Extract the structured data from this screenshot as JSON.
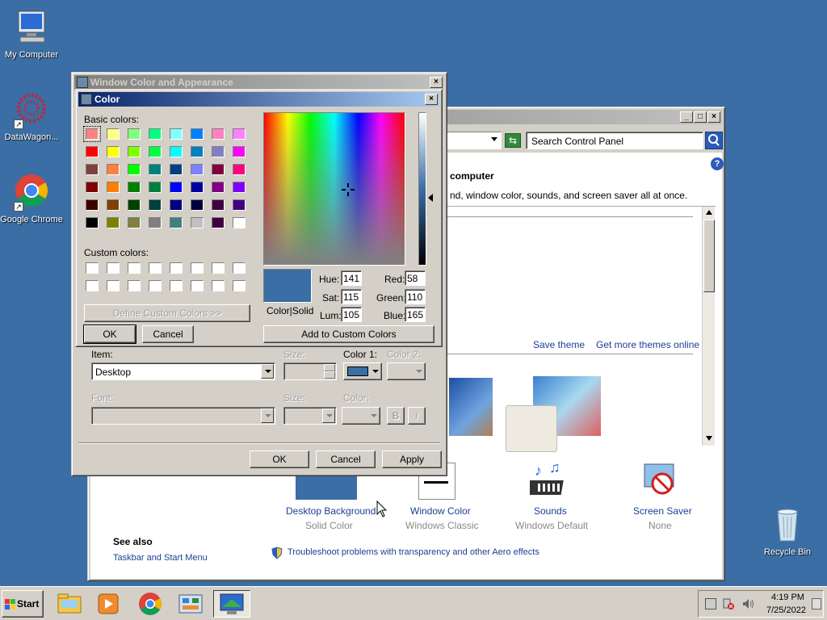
{
  "desktop": {
    "icons": [
      {
        "label": "My Computer"
      },
      {
        "label": "DataWagon..."
      },
      {
        "label": "Google Chrome"
      },
      {
        "label": "Recycle Bin"
      }
    ]
  },
  "control_panel": {
    "search_placeholder": "Search Control Panel",
    "heading": "computer",
    "subtext": "nd, window color, sounds, and screen saver all at once.",
    "save_theme": "Save theme",
    "get_more_themes": "Get more themes online",
    "items": [
      {
        "label": "Desktop Background",
        "sub": "Solid Color"
      },
      {
        "label": "Window Color",
        "sub": "Windows Classic"
      },
      {
        "label": "Sounds",
        "sub": "Windows Default"
      },
      {
        "label": "Screen Saver",
        "sub": "None"
      }
    ],
    "see_also": "See also",
    "see_also_link": "Taskbar and Start Menu",
    "troubleshoot": "Troubleshoot problems with transparency and other Aero effects"
  },
  "appearance_dialog": {
    "title": "Window Color and Appearance",
    "item_label": "Item:",
    "item_value": "Desktop",
    "size_label": "Size:",
    "color1_label": "Color 1:",
    "color2_label": "Color 2:",
    "font_label": "Font:",
    "font_size_label": "Size:",
    "font_color_label": "Color:",
    "bold_label": "B",
    "italic_label": "I",
    "ok": "OK",
    "cancel": "Cancel",
    "apply": "Apply",
    "color1_value": "#3a6ea5"
  },
  "color_dialog": {
    "title": "Color",
    "basic_colors_label": "Basic colors:",
    "custom_colors_label": "Custom colors:",
    "define_custom": "Define Custom Colors >>",
    "ok": "OK",
    "cancel": "Cancel",
    "add_custom": "Add to Custom Colors",
    "color_solid_label": "Color|Solid",
    "hue_label": "Hue:",
    "sat_label": "Sat:",
    "lum_label": "Lum:",
    "red_label": "Red:",
    "green_label": "Green:",
    "blue_label": "Blue:",
    "hue": "141",
    "sat": "115",
    "lum": "105",
    "red": "58",
    "green": "110",
    "blue": "165",
    "current_color": "#3a6ea5",
    "basic_colors": [
      "#ff8080",
      "#ffff80",
      "#80ff80",
      "#00ff80",
      "#80ffff",
      "#0080ff",
      "#ff80c0",
      "#ff80ff",
      "#ff0000",
      "#ffff00",
      "#80ff00",
      "#00ff40",
      "#00ffff",
      "#0080c0",
      "#8080c0",
      "#ff00ff",
      "#804040",
      "#ff8040",
      "#00ff00",
      "#008080",
      "#004080",
      "#8080ff",
      "#800040",
      "#ff0080",
      "#800000",
      "#ff8000",
      "#008000",
      "#008040",
      "#0000ff",
      "#0000a0",
      "#800080",
      "#8000ff",
      "#400000",
      "#804000",
      "#004000",
      "#004040",
      "#000080",
      "#000040",
      "#400040",
      "#400080",
      "#000000",
      "#808000",
      "#808040",
      "#808080",
      "#408080",
      "#c0c0c0",
      "#400040",
      "#ffffff"
    ]
  },
  "taskbar": {
    "start": "Start",
    "time": "4:19 PM",
    "date": "7/25/2022"
  }
}
